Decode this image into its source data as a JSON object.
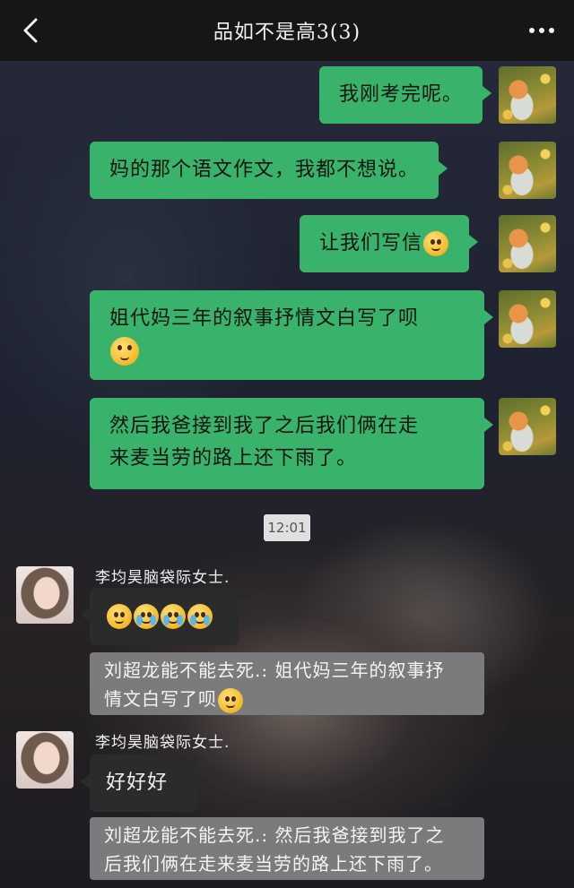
{
  "header": {
    "title": "品如不是高3(3)"
  },
  "my_messages": [
    {
      "text": "我刚考完呢。",
      "emoji": ""
    },
    {
      "text": "妈的那个语文作文，我都不想说。",
      "emoji": ""
    },
    {
      "text": "让我们写信",
      "emoji": "slight-smile"
    },
    {
      "text_line1": "姐代妈三年的叙事抒情文白写了呗",
      "emoji": "slight-smile"
    },
    {
      "text_line1": "然后我爸接到我了之后我们俩在走",
      "text_line2": "来麦当劳的路上还下雨了。"
    }
  ],
  "timestamp": "12:01",
  "other_messages": [
    {
      "sender": "李均昊脑袋际女士.",
      "emojis": [
        "eye-roll",
        "cry-laugh",
        "cry-laugh",
        "cry-laugh"
      ],
      "quote_line1": "刘超龙能不能去死.: 姐代妈三年的叙事抒",
      "quote_line2": "情文白写了呗"
    },
    {
      "sender": "李均昊脑袋际女士.",
      "text": "好好好",
      "quote_line1": "刘超龙能不能去死.: 然后我爸接到我了之",
      "quote_line2": "后我们俩在走来麦当劳的路上还下雨了。"
    }
  ],
  "colors": {
    "my_bubble": "#39b36b",
    "other_bubble": "#2b2b2b",
    "quote_bg": "#7b7a7d",
    "title_bar": "#161616"
  }
}
